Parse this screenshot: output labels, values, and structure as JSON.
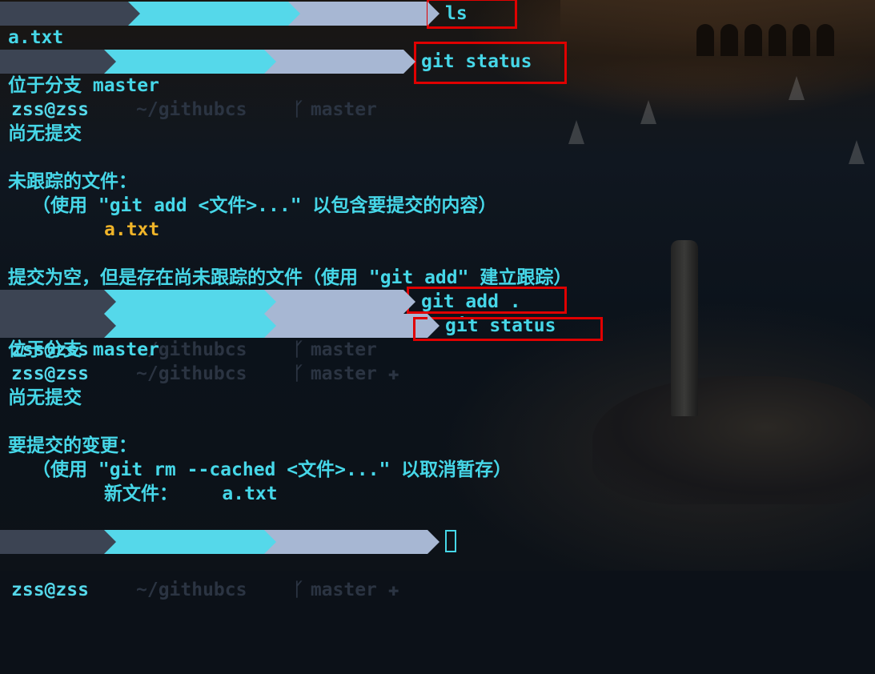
{
  "prompt": {
    "fail_mark": "✗",
    "user": "zss@zss",
    "dir": "~/githubcs",
    "branch": "master",
    "dirty_mark": "✚"
  },
  "lines": {
    "l1_cmd": "ls",
    "l2_out": "a.txt",
    "l3_cmd": "git status",
    "l4_out": "位于分支 master",
    "l6_out": "尚无提交",
    "l8_out": "未跟踪的文件：",
    "l9_out": "（使用 \"git add <文件>...\" 以包含要提交的内容）",
    "l10_file": "a.txt",
    "l12_out": "提交为空，但是存在尚未跟踪的文件（使用 \"git add\" 建立跟踪）",
    "l13_cmd": "git add .",
    "l14_cmd": "git status",
    "l15_out": "位于分支 master",
    "l17_out": "尚无提交",
    "l19_out": "要提交的变更：",
    "l20_out": "（使用 \"git rm --cached <文件>...\" 以取消暂存）",
    "l21_label": "新文件：",
    "l21_file": "a.txt"
  },
  "colors": {
    "text_cyan": "#46d7e8",
    "file_yellow": "#f0b429",
    "segment_dark": "#3c4453",
    "segment_cyan": "#55d8ea",
    "segment_blue": "#a7b7d3",
    "highlight_red": "#e00000"
  }
}
